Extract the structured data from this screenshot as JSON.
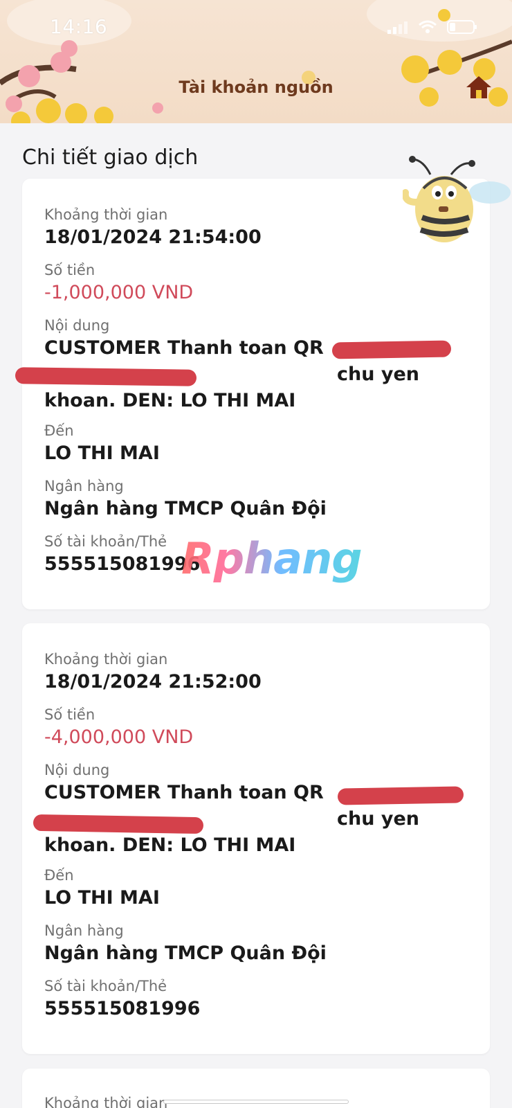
{
  "status_bar": {
    "time": "14:16"
  },
  "header": {
    "title": "Tài khoản nguồn"
  },
  "section": {
    "title": "Chi tiết giao dịch"
  },
  "watermark": {
    "text": "Rphang"
  },
  "labels": {
    "time": "Khoảng thời gian",
    "amount": "Số tiền",
    "content": "Nội dung",
    "to": "Đến",
    "bank": "Ngân hàng",
    "account": "Số tài khoản/Thẻ"
  },
  "transactions": [
    {
      "time": "18/01/2024 21:54:00",
      "amount": "-1,000,000 VND",
      "content": "CUSTOMER Thanh toan QR                                              chu yen khoan. DEN: LO THI MAI",
      "to": "LO THI MAI",
      "bank": "Ngân hàng TMCP Quân Đội",
      "account": "555515081996"
    },
    {
      "time": "18/01/2024 21:52:00",
      "amount": "-4,000,000 VND",
      "content": "CUSTOMER Thanh toan QR                                              chu yen khoan. DEN: LO THI MAI",
      "to": "LO THI MAI",
      "bank": "Ngân hàng TMCP Quân Đội",
      "account": "555515081996"
    }
  ],
  "colors": {
    "amount": "#d04a5a",
    "header_title": "#6e3a1e",
    "redaction": "#d4414b"
  },
  "icons": [
    "signal-icon",
    "wifi-icon",
    "battery-icon",
    "home-icon",
    "bee-mascot-icon"
  ]
}
